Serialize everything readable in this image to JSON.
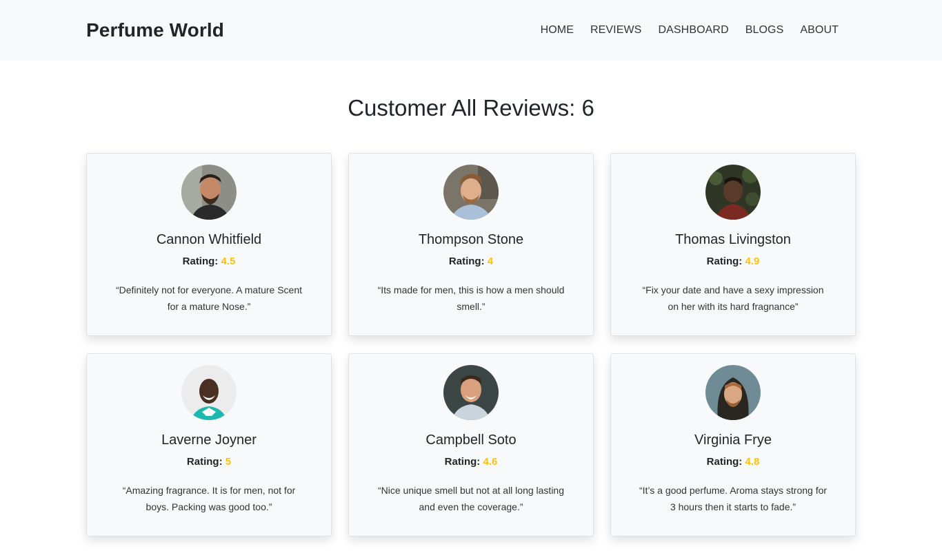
{
  "nav": {
    "brand": "Perfume World",
    "links": [
      "HOME",
      "REVIEWS",
      "DASHBOARD",
      "BLOGS",
      "ABOUT"
    ]
  },
  "page": {
    "title": "Customer All Reviews: 6"
  },
  "reviews": [
    {
      "name": "Cannon Whitfield",
      "rating_label": "Rating:",
      "rating": "4.5",
      "quote": "“Definitely not for everyone. A mature Scent for a mature Nose.”"
    },
    {
      "name": "Thompson Stone",
      "rating_label": "Rating:",
      "rating": "4",
      "quote": "“Its made for men, this is how a men should smell.”"
    },
    {
      "name": "Thomas Livingston",
      "rating_label": "Rating:",
      "rating": "4.9",
      "quote": "“Fix your date and have a sexy impression on her with its hard fragnance”"
    },
    {
      "name": "Laverne Joyner",
      "rating_label": "Rating:",
      "rating": "5",
      "quote": "“Amazing fragrance. It is for men, not for boys. Packing was good too.”"
    },
    {
      "name": "Campbell Soto",
      "rating_label": "Rating:",
      "rating": "4.6",
      "quote": "“Nice unique smell but not at all long lasting and even the coverage.”"
    },
    {
      "name": "Virginia Frye",
      "rating_label": "Rating:",
      "rating": "4.8",
      "quote": "“It’s a good perfume. Aroma stays strong for 3 hours then it starts to fade.”"
    }
  ],
  "colors": {
    "rating_accent": "#ffc107",
    "navbar_bg": "#f8f9fa",
    "card_bg": "#f8f9fa"
  }
}
